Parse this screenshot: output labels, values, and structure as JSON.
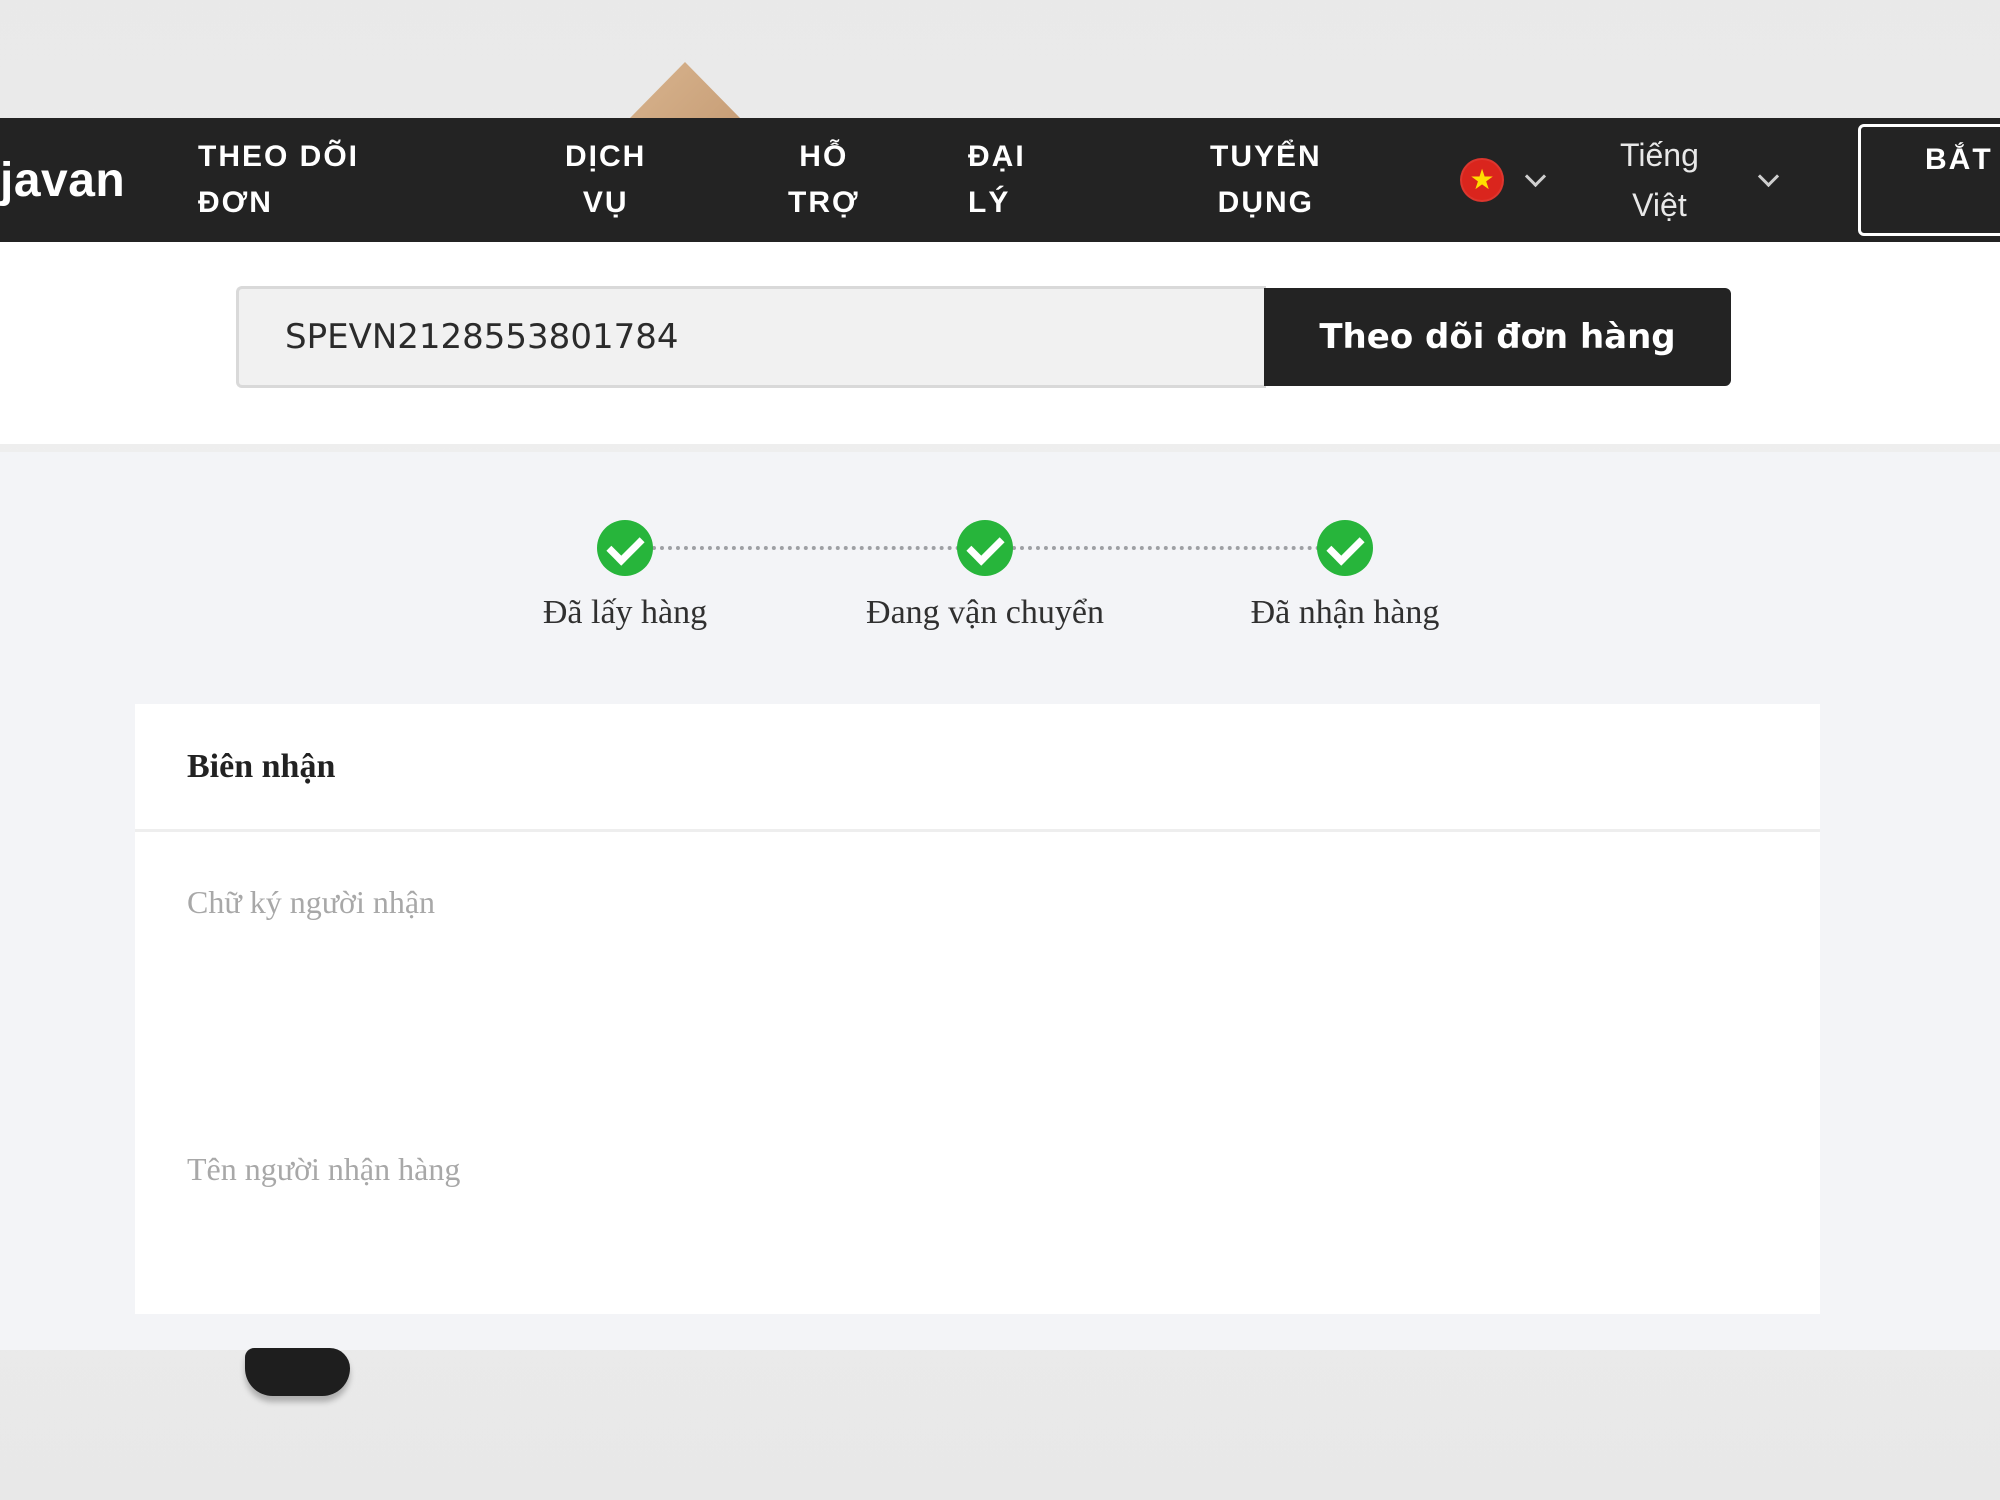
{
  "navbar": {
    "brand": "javan",
    "items": [
      {
        "line1": "THEO DÕI",
        "line2": "ĐƠN"
      },
      {
        "line1": "DỊCH",
        "line2": "VỤ"
      },
      {
        "line1": "HỖ",
        "line2": "TRỢ"
      },
      {
        "line1": "ĐẠI",
        "line2": "LÝ"
      },
      {
        "line1": "TUYỂN",
        "line2": "DỤNG"
      }
    ],
    "flag_icon": "vietnam-flag-icon",
    "language": {
      "line1": "Tiếng",
      "line2": "Việt"
    },
    "start_button_label": "BẮT"
  },
  "search": {
    "value": "SPEVN2128553801784",
    "button_label": "Theo dõi đơn hàng"
  },
  "progress": {
    "steps": [
      {
        "label": "Đã lấy hàng",
        "done": true
      },
      {
        "label": "Đang vận chuyển",
        "done": true
      },
      {
        "label": "Đã nhận hàng",
        "done": true
      }
    ],
    "check_color": "#27b53b"
  },
  "receipt": {
    "title": "Biên nhận",
    "signature_label": "Chữ ký người nhận",
    "receiver_name_label": "Tên người nhận hàng"
  }
}
